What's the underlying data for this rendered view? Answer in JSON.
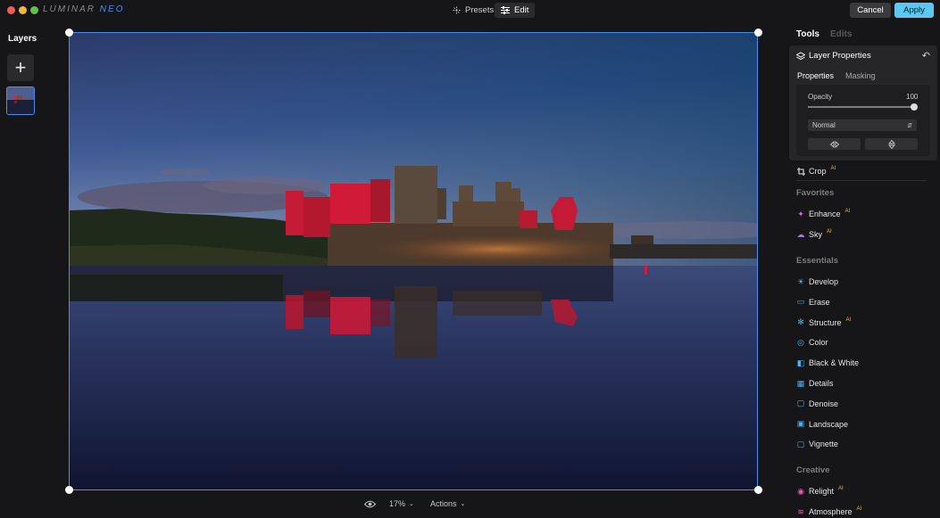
{
  "app": {
    "logo_left": "LUMINAR",
    "logo_right": "NEO"
  },
  "top_nav": {
    "presets": "Presets",
    "edit": "Edit"
  },
  "buttons": {
    "cancel": "Cancel",
    "apply": "Apply"
  },
  "layers_panel": {
    "title": "Layers"
  },
  "bottom_bar": {
    "zoom": "17%",
    "actions": "Actions"
  },
  "right_panel": {
    "tabs": {
      "tools": "Tools",
      "edits": "Edits"
    },
    "layer_properties": {
      "title": "Layer Properties",
      "subtabs": {
        "properties": "Properties",
        "masking": "Masking"
      },
      "opacity_label": "Opacity",
      "opacity_value": "100",
      "blend_mode": "Normal"
    },
    "crop": {
      "label": "Crop",
      "badge": "AI"
    },
    "sections": {
      "favorites": "Favorites",
      "essentials": "Essentials",
      "creative": "Creative"
    },
    "favorites": [
      {
        "label": "Enhance",
        "badge": "AI",
        "icon": "enhance-icon",
        "color": "#c46bf0"
      },
      {
        "label": "Sky",
        "badge": "AI",
        "icon": "sky-icon",
        "color": "#b36bf0"
      }
    ],
    "essentials": [
      {
        "label": "Develop",
        "badge": "",
        "icon": "develop-icon",
        "color": "#4fb0f0"
      },
      {
        "label": "Erase",
        "badge": "",
        "icon": "erase-icon",
        "color": "#4fb0f0"
      },
      {
        "label": "Structure",
        "badge": "AI",
        "icon": "structure-icon",
        "color": "#4fb0f0"
      },
      {
        "label": "Color",
        "badge": "",
        "icon": "color-icon",
        "color": "#4fb0f0"
      },
      {
        "label": "Black & White",
        "badge": "",
        "icon": "black-white-icon",
        "color": "#4fb0f0"
      },
      {
        "label": "Details",
        "badge": "",
        "icon": "details-icon",
        "color": "#4fb0f0"
      },
      {
        "label": "Denoise",
        "badge": "",
        "icon": "denoise-icon",
        "color": "#4fb0f0"
      },
      {
        "label": "Landscape",
        "badge": "",
        "icon": "landscape-icon",
        "color": "#4fb0f0"
      },
      {
        "label": "Vignette",
        "badge": "",
        "icon": "vignette-icon",
        "color": "#4fb0f0"
      }
    ],
    "creative": [
      {
        "label": "Relight",
        "badge": "AI",
        "icon": "relight-icon",
        "color": "#e85bb8"
      },
      {
        "label": "Atmosphere",
        "badge": "AI",
        "icon": "atmosphere-icon",
        "color": "#e85bb8"
      }
    ]
  },
  "colors": {
    "accent": "#4a8ef0",
    "apply": "#5bc8ef",
    "ai_badge": "#f0b43b"
  }
}
